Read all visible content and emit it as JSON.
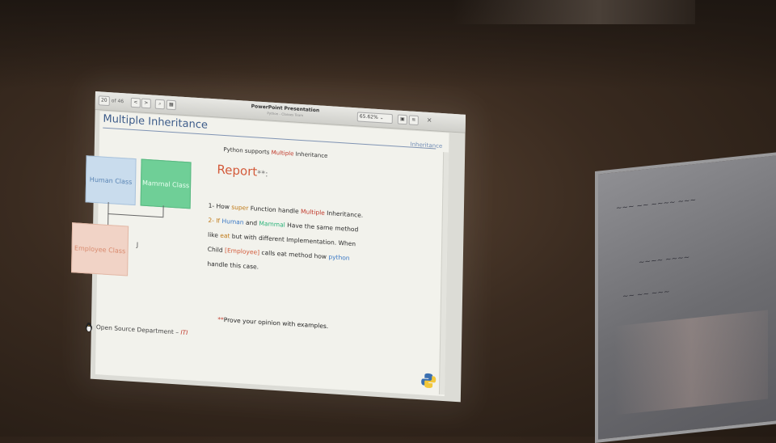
{
  "toolbar": {
    "page": "20",
    "page_of": "of 46",
    "title": "PowerPoint Presentation",
    "subtitle": "Python - Classes Team",
    "zoom": "65.62%"
  },
  "slide": {
    "title": "Multiple Inheritance",
    "section_tag": "Inheritance",
    "subtitle_pre": "Python supports ",
    "subtitle_hl": "Multiple",
    "subtitle_post": " Inheritance",
    "report": "Report",
    "report_mark": "**:",
    "boxes": {
      "human": "Human Class",
      "mammal": "Mammal Class",
      "employee": "Employee Class"
    },
    "q1_a": "1- How ",
    "q1_super": "super",
    "q1_b": " Function handle ",
    "q1_multiple": "Multiple",
    "q1_c": " Inheritance.",
    "q2_a": "2- If  ",
    "q2_human": "Human",
    "q2_b": " and ",
    "q2_mammal": "Mammal",
    "q2_c": " Have the same method",
    "q3_a": "like ",
    "q3_eat": "eat",
    "q3_b": " but with different Implementation. When",
    "q4_a": "Child ",
    "q4_emp": "[Employee]",
    "q4_b": " calls eat method how ",
    "q4_py": "python",
    "q5": "handle this case.",
    "prove_stars": "**",
    "prove_text": "Prove your opinion with examples.",
    "footer_text": "Open Source Department – ",
    "footer_brand": "ITI"
  },
  "colors": {
    "title": "#3d5c8a",
    "highlight_red": "#c0392b",
    "highlight_blue": "#3a78c5",
    "highlight_teal": "#2bb37a"
  }
}
